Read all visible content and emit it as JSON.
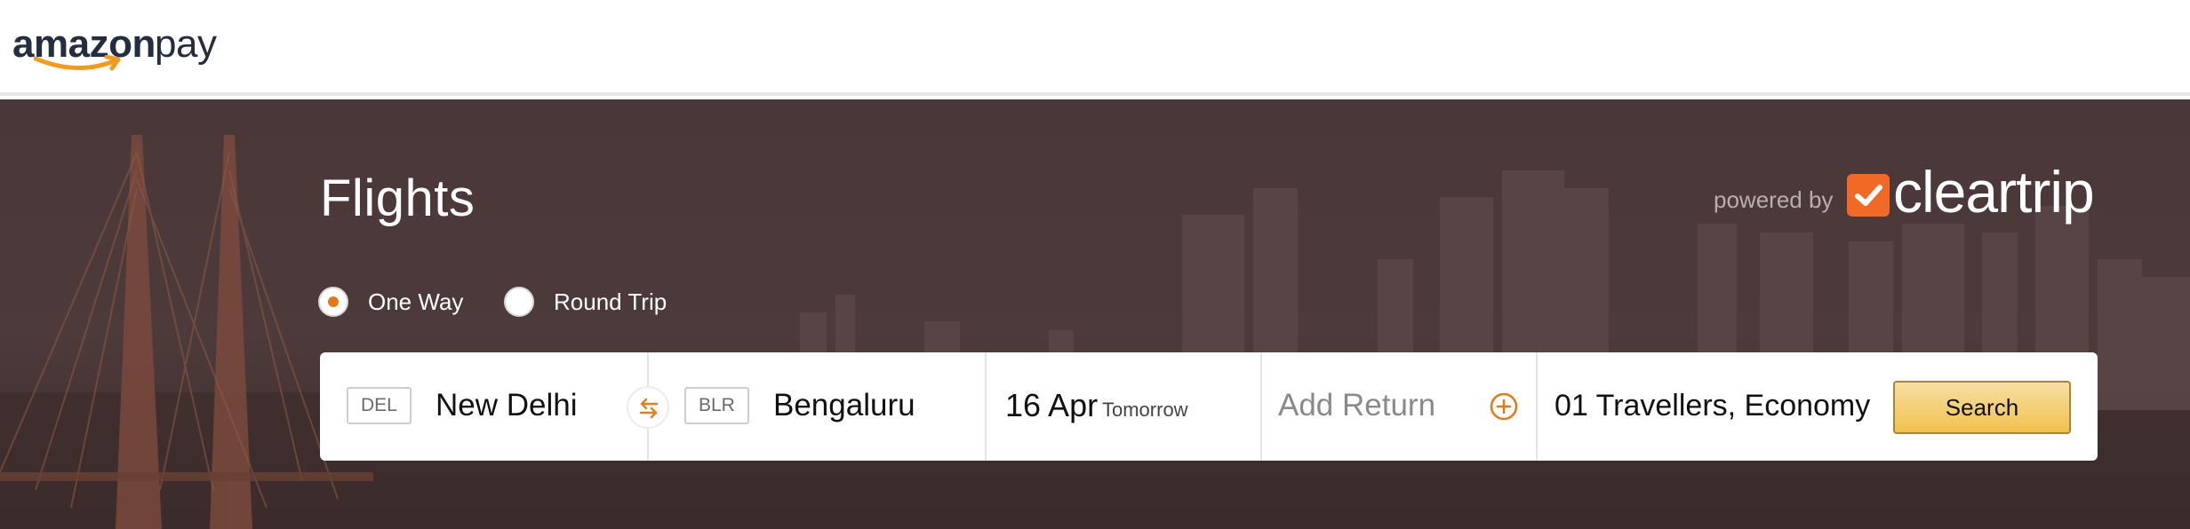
{
  "header": {
    "logo_amazon": "amazon",
    "logo_pay": "pay"
  },
  "search": {
    "title": "Flights",
    "powered_by": "powered by",
    "partner_name": "cleartrip",
    "trip_types": [
      {
        "label": "One Way",
        "selected": true
      },
      {
        "label": "Round Trip",
        "selected": false
      }
    ],
    "from": {
      "code": "DEL",
      "city": "New Delhi"
    },
    "to": {
      "code": "BLR",
      "city": "Bengaluru"
    },
    "depart": {
      "date": "16 Apr",
      "hint": "Tomorrow"
    },
    "return_label": "Add Return",
    "travellers": "01 Travellers, Economy",
    "search_label": "Search"
  },
  "colors": {
    "accent": "#e47911",
    "partner_brand": "#f06a26",
    "button_top": "#f7dfa5",
    "button_bottom": "#f0c14b",
    "hero_bg": "#4a3838"
  },
  "icons": {
    "swap": "swap-arrows-icon",
    "add_return": "plus-circle-icon",
    "partner_logo": "checkmark-icon",
    "logo_smile": "smile-arrow-icon"
  }
}
